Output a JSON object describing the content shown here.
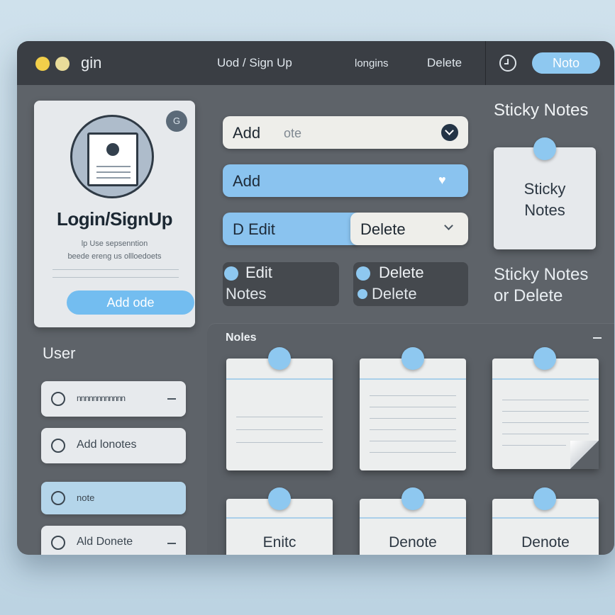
{
  "titlebar": {
    "app_name": "gin",
    "nav": [
      "Uod / Sign Up",
      "longins",
      "Delete"
    ],
    "note_button": "Noto"
  },
  "login_card": {
    "badge": "G",
    "title": "Login/SignUp",
    "sub1": "lp Use sepsenntion",
    "sub2": "beede ereng us ollloedoets",
    "button": "Add ode"
  },
  "user": {
    "heading": "User",
    "items": [
      {
        "label": "nnnnnnnnnnnn"
      },
      {
        "label": "Add lonotes"
      },
      {
        "label": "note"
      },
      {
        "label": "Ald Donete"
      }
    ]
  },
  "form": {
    "field1": {
      "label": "Add",
      "hint": "ote"
    },
    "field2": {
      "label": "Add"
    },
    "field3": {
      "left": "D Edit",
      "right": "Delete"
    }
  },
  "mini_cards": [
    {
      "line1": "Edit",
      "line2": "Notes"
    },
    {
      "line1": "Delete",
      "line2": "Delete"
    }
  ],
  "sticky": {
    "title": "Sticky Notes",
    "card_line1": "Sticky",
    "card_line2": "Notes",
    "note1": "Sticky Notes",
    "note2": "or Delete"
  },
  "notes_panel": {
    "label": "Noles",
    "bottom_labels": [
      "Enitc",
      "Denote",
      "Denote"
    ]
  },
  "colors": {
    "accent": "#8ec8f0",
    "window": "#5e6369",
    "titlebar": "#3a3e44"
  }
}
